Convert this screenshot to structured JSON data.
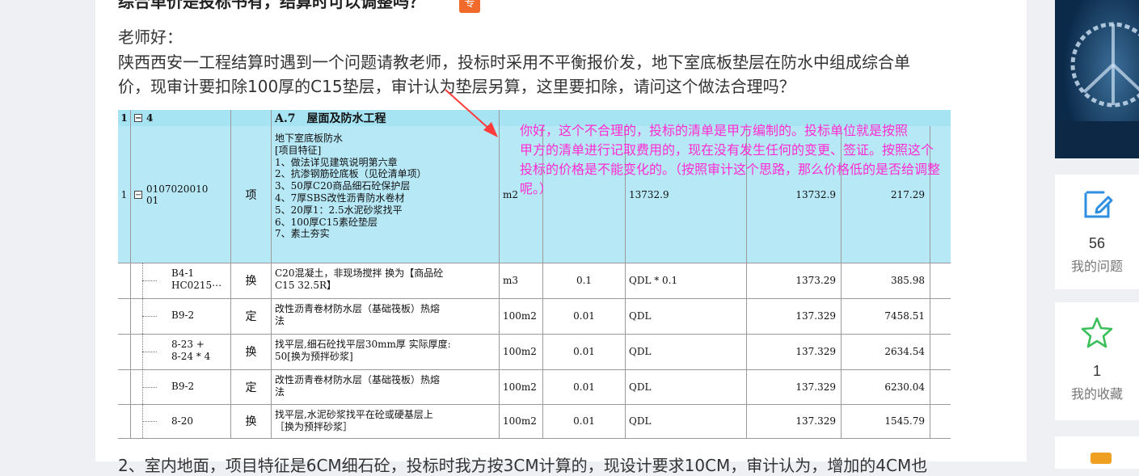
{
  "question": {
    "title": "综合单价是投标书有，结算时可以调整吗？",
    "tag": "专",
    "greeting": "老师好：",
    "line1": "陕西西安一工程结算时遇到一个问题请教老师，投标时采用不平衡报价发，地下室底板垫层在防水中组成综合单",
    "line2": "价，现审计要扣除100厚的C15垫层，审计认为垫层另算，这里要扣除，请问这个做法合理吗？",
    "bottom": "2、室内地面，项目特征是6CM细石砼，投标时我方按3CM计算的，现设计要求10CM，审计认为，增加的4CM也"
  },
  "table": {
    "head": {
      "seq": "1",
      "code": "4",
      "name": "A.7　屋面及防水工程"
    },
    "main": {
      "seq": "1",
      "code1": "0107020010",
      "code2": "01",
      "type": "项",
      "desc": [
        "地下室底板防水",
        "[项目特征]",
        "1、做法详见建筑说明第六章",
        "2、抗渗钢筋砼底板（见砼清单项）",
        "3、50厚C20商品细石砼保护层",
        "4、7厚SBS改性沥青防水卷材",
        "5、20厚1：2.5水泥砂浆找平",
        "6、100厚C15素砼垫层",
        "7、素土夯实"
      ],
      "unit": "m2",
      "expr": "13732.9",
      "qty": "13732.9",
      "price": "217.29"
    },
    "rows": [
      {
        "code": [
          "B4-1",
          "HC0215⋯"
        ],
        "type": "换",
        "desc": [
          "C20混凝土，非现场搅拌 换为【商品砼",
          "C15 32.5R】"
        ],
        "unit": "m3",
        "factor": "0.1",
        "expr": "QDL * 0.1",
        "qty": "1373.29",
        "price": "385.98"
      },
      {
        "code": [
          "B9-2"
        ],
        "type": "定",
        "desc": [
          "改性沥青卷材防水层（基础筏板）热熔",
          "法"
        ],
        "unit": "100m2",
        "factor": "0.01",
        "expr": "QDL",
        "qty": "137.329",
        "price": "7458.51"
      },
      {
        "code": [
          "8-23 +",
          "8-24 * 4"
        ],
        "type": "换",
        "desc": [
          "找平层,细石砼找平层30mm厚 实际厚度:",
          "50[换为预拌砂浆]"
        ],
        "unit": "100m2",
        "factor": "0.01",
        "expr": "QDL",
        "qty": "137.329",
        "price": "2634.54"
      },
      {
        "code": [
          "B9-2"
        ],
        "type": "定",
        "desc": [
          "改性沥青卷材防水层（基础筏板）热熔",
          "法"
        ],
        "unit": "100m2",
        "factor": "0.01",
        "expr": "QDL",
        "qty": "137.329",
        "price": "6230.04"
      },
      {
        "code": [
          "8-20"
        ],
        "type": "换",
        "desc": [
          "找平层,水泥砂浆找平在砼或硬基层上",
          "［换为预拌砂浆］"
        ],
        "unit": "100m2",
        "factor": "0.01",
        "expr": "QDL",
        "qty": "137.329",
        "price": "1545.79"
      }
    ]
  },
  "annotation": {
    "color": "#ff2bd3",
    "lines": [
      "你好，这个不合理的，投标的清单是甲方编制的。投标单位就是按照",
      "甲方的清单进行记取费用的，现在没有发生任何的变更、签证。按照这个",
      "投标的价格是不能变化的。（按照审计这个思路，那么价格低的是否给调整",
      "呢。）"
    ]
  },
  "sidebar": {
    "questions": {
      "count": "56",
      "label": "我的问题",
      "icon": "edit-icon"
    },
    "favorites": {
      "count": "1",
      "label": "我的收藏",
      "icon": "star-icon"
    }
  }
}
